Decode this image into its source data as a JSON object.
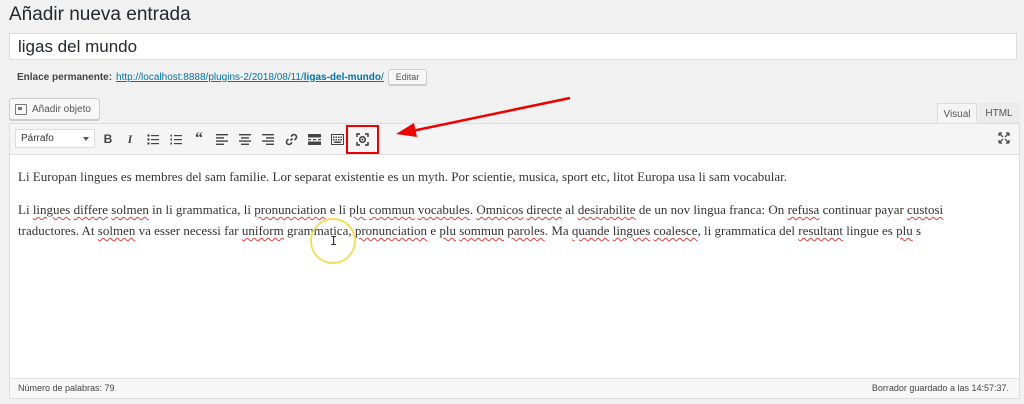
{
  "header": {
    "title": "Añadir nueva entrada"
  },
  "post": {
    "title": "ligas del mundo"
  },
  "permalink": {
    "label": "Enlace permanente:",
    "url_prefix": "http://localhost:8888/plugins-2/2018/08/11/",
    "url_slug": "ligas-del-mundo",
    "url_suffix": "/",
    "edit_label": "Editar"
  },
  "media": {
    "button_label": "Añadir objeto"
  },
  "tabs": {
    "visual": "Visual",
    "html": "HTML"
  },
  "toolbar": {
    "format_select": "Párrafo",
    "buttons": [
      "bold",
      "italic",
      "bullet-list",
      "numbered-list",
      "blockquote",
      "align-left",
      "align-center",
      "align-right",
      "insert-link",
      "read-more",
      "toolbar-toggle",
      "custom-plugin"
    ]
  },
  "content": {
    "p1": "Li Europan lingues es membres del sam familie. Lor separat existentie es un myth. Por scientie, musica, sport etc, litot Europa usa li sam vocabular.",
    "p2": {
      "parts": [
        "Li ",
        "lingues",
        " ",
        "differe",
        " ",
        "solmen",
        " in li grammatica, li ",
        "pronunciation",
        " e li ",
        "plu",
        " ",
        "commun",
        " ",
        "vocabules",
        ". ",
        "Omnicos",
        " ",
        "directe",
        " al ",
        "desirabilite",
        " de un nov lingua franca: On ",
        "refusa",
        " continuar payar ",
        "custosi",
        " traductores. At ",
        "solmen",
        " va esser necessi far ",
        "uniform",
        " grammatica, ",
        "pronunciation",
        " e ",
        "plu",
        " ",
        "sommun",
        " ",
        "paroles",
        ". Ma ",
        "quande",
        " ",
        "lingues",
        " ",
        "coalesce",
        ", li grammatica del ",
        "resultant",
        " lingue es ",
        "plu",
        " s"
      ]
    }
  },
  "status": {
    "word_count": "Número de palabras: 79",
    "draft_saved": "Borrador guardado a las 14:57:37."
  },
  "colors": {
    "link": "#0073aa",
    "highlight": "#e00000",
    "spellcheck": "#e04040"
  }
}
